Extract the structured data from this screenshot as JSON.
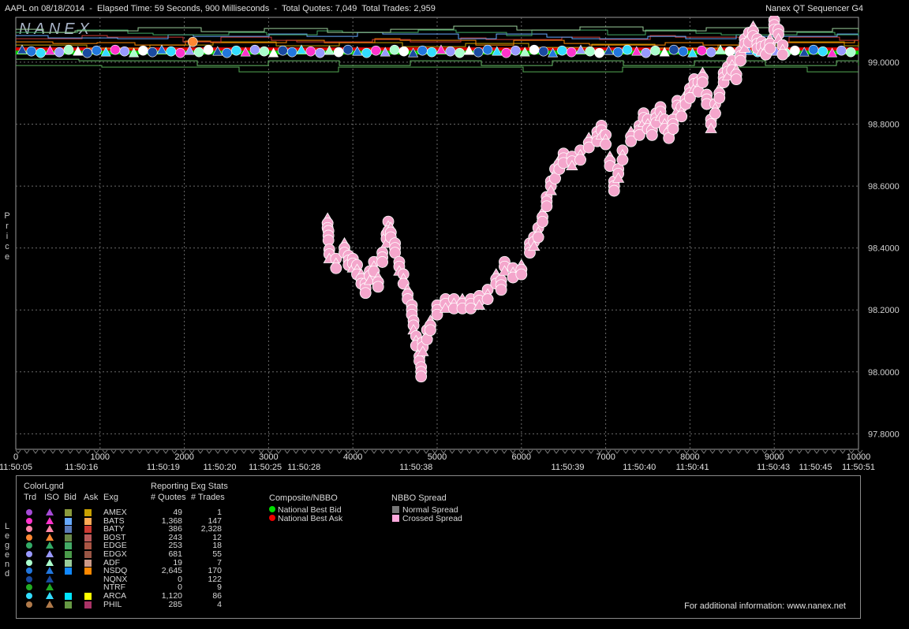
{
  "title": {
    "left": "AAPL on 08/18/2014  -  Elapsed Time: 59 Seconds, 900 Milliseconds  -  Total Quotes: 7,049  Total Trades: 2,959",
    "right": "Nanex QT Sequencer G4"
  },
  "logo": "NANEX",
  "side_labels": {
    "price": "Price",
    "legend": "Legend"
  },
  "chart_data": {
    "type": "scatter",
    "xlabel": "",
    "ylabel": "Price",
    "xlim": [
      0,
      10000
    ],
    "ylim": [
      97.75,
      99.15
    ],
    "x_ticks": [
      "0",
      "1000",
      "2000",
      "3000",
      "4000",
      "5000",
      "6000",
      "7000",
      "8000",
      "9000",
      "10000"
    ],
    "y_ticks": [
      "97.8000",
      "98.0000",
      "98.2000",
      "98.4000",
      "98.6000",
      "98.8000",
      "99.0000"
    ],
    "time_labels": [
      {
        "x": 0,
        "label": "11:50:05"
      },
      {
        "x": 780,
        "label": "11:50:16"
      },
      {
        "x": 1750,
        "label": "11:50:19"
      },
      {
        "x": 2420,
        "label": "11:50:20"
      },
      {
        "x": 2960,
        "label": "11:50:25"
      },
      {
        "x": 3420,
        "label": "11:50:28"
      },
      {
        "x": 4750,
        "label": "11:50:38"
      },
      {
        "x": 6550,
        "label": "11:50:39"
      },
      {
        "x": 7400,
        "label": "11:50:40"
      },
      {
        "x": 8030,
        "label": "11:50:41"
      },
      {
        "x": 8990,
        "label": "11:50:43"
      },
      {
        "x": 9490,
        "label": "11:50:45"
      },
      {
        "x": 10000,
        "label": "11:50:51"
      }
    ],
    "series": [
      {
        "name": "Crossed Spread",
        "color": "#f4a6cc",
        "points": [
          [
            3700,
            98.48
          ],
          [
            3710,
            98.44
          ],
          [
            3720,
            98.38
          ],
          [
            3800,
            98.35
          ],
          [
            3900,
            98.4
          ],
          [
            3950,
            98.36
          ],
          [
            4000,
            98.35
          ],
          [
            4050,
            98.33
          ],
          [
            4100,
            98.3
          ],
          [
            4150,
            98.27
          ],
          [
            4200,
            98.31
          ],
          [
            4250,
            98.34
          ],
          [
            4300,
            98.29
          ],
          [
            4350,
            98.37
          ],
          [
            4400,
            98.43
          ],
          [
            4420,
            98.47
          ],
          [
            4450,
            98.45
          ],
          [
            4500,
            98.4
          ],
          [
            4550,
            98.34
          ],
          [
            4600,
            98.3
          ],
          [
            4650,
            98.25
          ],
          [
            4700,
            98.2
          ],
          [
            4720,
            98.15
          ],
          [
            4750,
            98.1
          ],
          [
            4790,
            98.05
          ],
          [
            4810,
            98.0
          ],
          [
            4830,
            98.08
          ],
          [
            4880,
            98.12
          ],
          [
            4920,
            98.15
          ],
          [
            5000,
            98.2
          ],
          [
            5100,
            98.22
          ],
          [
            5200,
            98.22
          ],
          [
            5300,
            98.22
          ],
          [
            5400,
            98.22
          ],
          [
            5500,
            98.23
          ],
          [
            5600,
            98.25
          ],
          [
            5700,
            98.3
          ],
          [
            5760,
            98.28
          ],
          [
            5800,
            98.34
          ],
          [
            5900,
            98.32
          ],
          [
            6000,
            98.33
          ],
          [
            6100,
            98.4
          ],
          [
            6150,
            98.42
          ],
          [
            6200,
            98.45
          ],
          [
            6250,
            98.5
          ],
          [
            6300,
            98.55
          ],
          [
            6350,
            98.6
          ],
          [
            6400,
            98.64
          ],
          [
            6450,
            98.67
          ],
          [
            6500,
            98.69
          ],
          [
            6600,
            98.68
          ],
          [
            6700,
            98.7
          ],
          [
            6800,
            98.74
          ],
          [
            6900,
            98.76
          ],
          [
            6950,
            98.78
          ],
          [
            7000,
            98.75
          ],
          [
            7050,
            98.68
          ],
          [
            7100,
            98.6
          ],
          [
            7150,
            98.64
          ],
          [
            7200,
            98.7
          ],
          [
            7300,
            98.76
          ],
          [
            7400,
            98.78
          ],
          [
            7450,
            98.82
          ],
          [
            7500,
            98.8
          ],
          [
            7550,
            98.78
          ],
          [
            7600,
            98.82
          ],
          [
            7650,
            98.84
          ],
          [
            7700,
            98.8
          ],
          [
            7750,
            98.77
          ],
          [
            7800,
            98.8
          ],
          [
            7850,
            98.86
          ],
          [
            7900,
            98.84
          ],
          [
            7950,
            98.88
          ],
          [
            8000,
            98.9
          ],
          [
            8050,
            98.93
          ],
          [
            8100,
            98.92
          ],
          [
            8150,
            98.95
          ],
          [
            8200,
            98.88
          ],
          [
            8250,
            98.8
          ],
          [
            8300,
            98.85
          ],
          [
            8350,
            98.9
          ],
          [
            8400,
            98.95
          ],
          [
            8450,
            98.97
          ],
          [
            8500,
            98.99
          ],
          [
            8550,
            98.96
          ],
          [
            8600,
            99.02
          ],
          [
            8650,
            99.06
          ],
          [
            8700,
            99.08
          ],
          [
            8750,
            99.1
          ],
          [
            8800,
            99.06
          ],
          [
            8850,
            99.05
          ],
          [
            8900,
            99.04
          ],
          [
            8950,
            99.06
          ],
          [
            9000,
            99.12
          ],
          [
            9050,
            99.09
          ],
          [
            9100,
            99.04
          ]
        ]
      }
    ],
    "quote_band": {
      "y": 99.03
    }
  },
  "legend": {
    "color_legend_title": "ColorLgnd",
    "reporting_title": "Reporting Exg Stats",
    "headers": {
      "trd": "Trd",
      "iso": "ISO",
      "bid": "Bid",
      "ask": "Ask",
      "exg": "Exg",
      "quotes": "# Quotes",
      "trades": "# Trades"
    },
    "rows": [
      {
        "exg": "AMEX",
        "quotes": "49",
        "trades": "1",
        "trd": "#a54bd6",
        "bid": "#8a9a3c",
        "ask": "#c8a000"
      },
      {
        "exg": "BATS",
        "quotes": "1,368",
        "trades": "147",
        "trd": "#ff33cc",
        "bid": "#66aaff",
        "ask": "#ffaa55"
      },
      {
        "exg": "BATY",
        "quotes": "386",
        "trades": "2,328",
        "trd": "#ff88aa",
        "bid": "#5a7ab8",
        "ask": "#cc3a33"
      },
      {
        "exg": "BOST",
        "quotes": "243",
        "trades": "12",
        "trd": "#ff8833",
        "bid": "#6a8a4a",
        "ask": "#b85a5a"
      },
      {
        "exg": "EDGE",
        "quotes": "253",
        "trades": "18",
        "trd": "#33aa66",
        "bid": "#44aa66",
        "ask": "#aa5544"
      },
      {
        "exg": "EDGX",
        "quotes": "681",
        "trades": "55",
        "trd": "#9999ff",
        "bid": "#4a9a4a",
        "ask": "#995544"
      },
      {
        "exg": "ADF",
        "quotes": "19",
        "trades": "7",
        "trd": "#aaffcc",
        "bid": "#99cc99",
        "ask": "#cc9988"
      },
      {
        "exg": "NSDQ",
        "quotes": "2,645",
        "trades": "170",
        "trd": "#2277dd",
        "bid": "#1188ff",
        "ask": "#ff8800"
      },
      {
        "exg": "NQNX",
        "quotes": "0",
        "trades": "122",
        "trd": "#1a4aa0",
        "bid": "",
        "ask": ""
      },
      {
        "exg": "NTRF",
        "quotes": "0",
        "trades": "9",
        "trd": "#22aa22",
        "bid": "",
        "ask": ""
      },
      {
        "exg": "ARCA",
        "quotes": "1,120",
        "trades": "86",
        "trd": "#33ddff",
        "bid": "#00e5ff",
        "ask": "#ffff00"
      },
      {
        "exg": "PHIL",
        "quotes": "285",
        "trades": "4",
        "trd": "#b07a4a",
        "bid": "#669944",
        "ask": "#aa3366"
      }
    ],
    "composite_title": "Composite/NBBO",
    "composite_items": [
      {
        "label": "National Best Bid",
        "color": "#00dd00"
      },
      {
        "label": "National Best Ask",
        "color": "#ee0000"
      }
    ],
    "spread_title": "NBBO Spread",
    "spread_items": [
      {
        "label": "Normal Spread",
        "color": "#777777"
      },
      {
        "label": "Crossed Spread",
        "color": "#ffaadd"
      }
    ]
  },
  "footer": "For additional information: www.nanex.net"
}
